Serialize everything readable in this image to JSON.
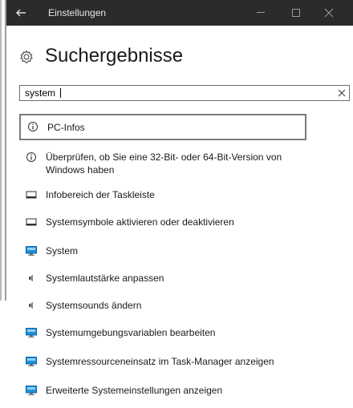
{
  "window": {
    "title": "Einstellungen"
  },
  "header": {
    "title": "Suchergebnisse"
  },
  "search": {
    "value": "system"
  },
  "results": [
    {
      "label": "PC-Infos",
      "icon": "info-icon"
    },
    {
      "label": "Überprüfen, ob Sie eine 32-Bit- oder 64-Bit-Version von Windows haben",
      "icon": "info-icon"
    },
    {
      "label": "Infobereich der Taskleiste",
      "icon": "taskbar-icon"
    },
    {
      "label": "Systemsymbole aktivieren oder deaktivieren",
      "icon": "taskbar-icon"
    },
    {
      "label": "System",
      "icon": "monitor-icon"
    },
    {
      "label": "Systemlautstärke anpassen",
      "icon": "speaker-icon"
    },
    {
      "label": "Systemsounds ändern",
      "icon": "speaker-icon"
    },
    {
      "label": "Systemumgebungsvariablen bearbeiten",
      "icon": "monitor-icon"
    },
    {
      "label": "Systemressourceneinsatz im Task-Manager anzeigen",
      "icon": "monitor-icon"
    },
    {
      "label": "Erweiterte Systemeinstellungen anzeigen",
      "icon": "monitor-icon"
    }
  ],
  "colors": {
    "titlebar": "#2b2b2b",
    "accent": "#1e90d8"
  }
}
